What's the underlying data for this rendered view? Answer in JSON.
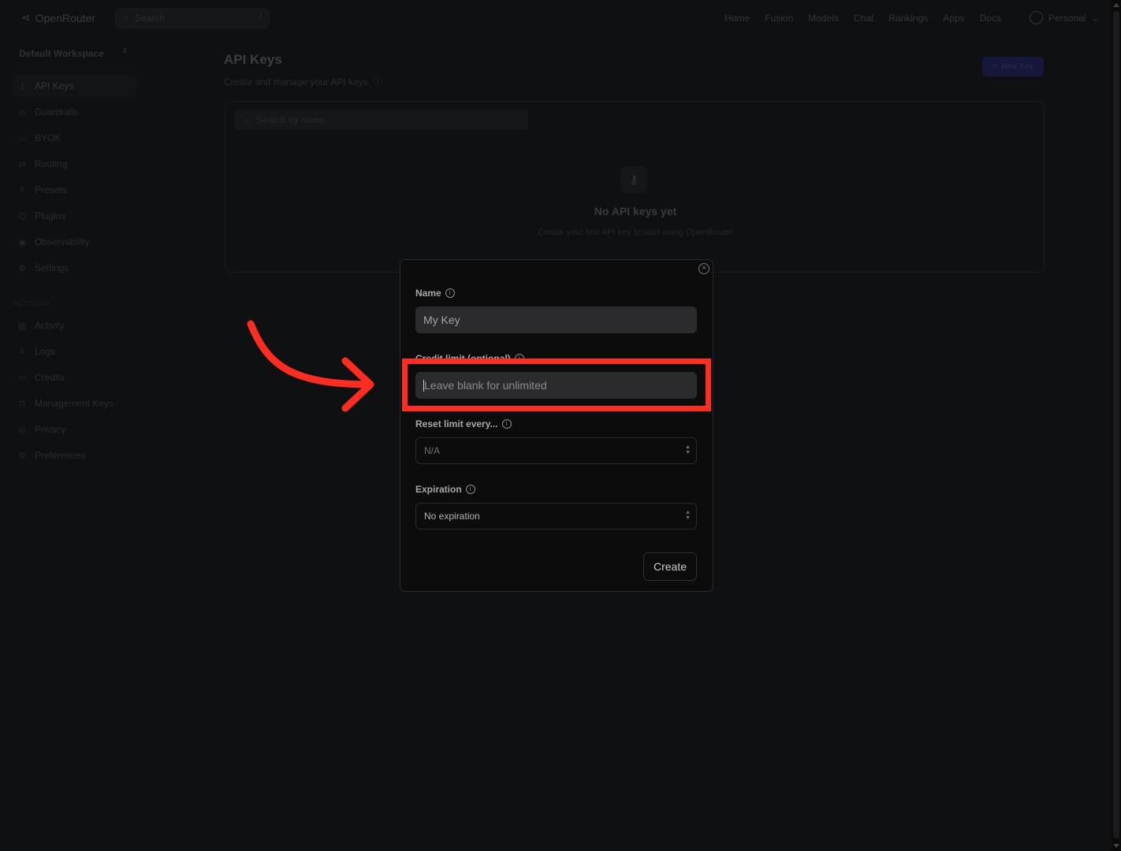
{
  "topnav": {
    "brand": "OpenRouter",
    "search_placeholder": "Search",
    "search_shortcut": "/",
    "links": [
      "Home",
      "Fusion",
      "Models",
      "Chat",
      "Rankings",
      "Apps",
      "Docs"
    ],
    "account_label": "Personal"
  },
  "sidebar": {
    "workspace": "Default Workspace",
    "items": [
      {
        "label": "API Keys",
        "icon": "key-icon",
        "active": true
      },
      {
        "label": "Guardrails",
        "icon": "shield-icon"
      },
      {
        "label": "BYOK",
        "icon": "card-icon"
      },
      {
        "label": "Routing",
        "icon": "route-icon"
      },
      {
        "label": "Presets",
        "icon": "list-icon"
      },
      {
        "label": "Plugins",
        "icon": "plug-icon"
      },
      {
        "label": "Observability",
        "icon": "eye-icon"
      },
      {
        "label": "Settings",
        "icon": "gear-icon"
      }
    ],
    "account_section_label": "ACCOUNT",
    "account_items": [
      {
        "label": "Activity",
        "icon": "chart-icon"
      },
      {
        "label": "Logs",
        "icon": "list-icon"
      },
      {
        "label": "Credits",
        "icon": "card-icon"
      },
      {
        "label": "Management Keys",
        "icon": "lock-icon"
      },
      {
        "label": "Privacy",
        "icon": "shield-icon"
      },
      {
        "label": "Preferences",
        "icon": "gear-icon"
      }
    ]
  },
  "main": {
    "title": "API Keys",
    "subtitle": "Create and manage your API keys.",
    "new_key_label": "New Key",
    "search_placeholder": "Search by name...",
    "empty_title": "No API keys yet",
    "empty_subtitle": "Create your first API key to start using OpenRouter"
  },
  "modal": {
    "name_label": "Name",
    "name_value": "My Key",
    "credit_label": "Credit limit (optional)",
    "credit_placeholder": "Leave blank for unlimited",
    "reset_label": "Reset limit every...",
    "reset_value": "N/A",
    "expiration_label": "Expiration",
    "expiration_value": "No expiration",
    "create_label": "Create"
  },
  "annotation": {
    "highlight_color": "#ff2d20"
  }
}
